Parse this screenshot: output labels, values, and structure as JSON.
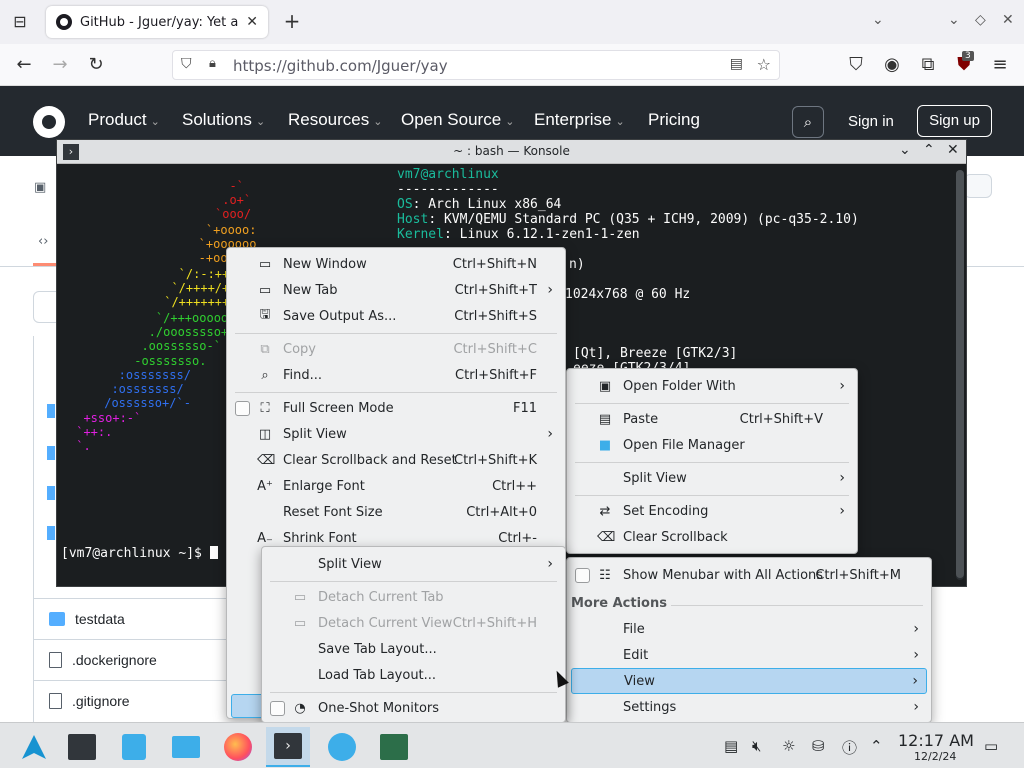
{
  "browser": {
    "tab_title": "GitHub - Jguer/yay: Yet an",
    "url": "https://github.com/Jguer/yay",
    "extension_badge": "3",
    "icons": [
      "tab-list-icon",
      "close-icon",
      "plus-icon",
      "chevron-down-icon",
      "minimize-icon",
      "restore-icon",
      "close-icon",
      "back-icon",
      "forward-icon",
      "reload-icon",
      "shield-icon",
      "lock-icon",
      "reader-icon",
      "star-icon",
      "pocket-icon",
      "account-icon",
      "extensions-icon",
      "ublock-icon",
      "hamburger-icon"
    ]
  },
  "github": {
    "nav": [
      "Product",
      "Solutions",
      "Resources",
      "Open Source",
      "Enterprise",
      "Pricing"
    ],
    "sign_in": "Sign in",
    "sign_up": "Sign up",
    "files": [
      "testdata",
      ".dockerignore",
      ".gitignore"
    ]
  },
  "konsole": {
    "title": "~ : bash — Konsole",
    "user_host": "vm7@archlinux",
    "separator": "-------------",
    "os_key": "OS",
    "os_val": ": Arch Linux x86_64",
    "host_key": "Host",
    "host_val": ": KVM/QEMU Standard PC (Q35 + ICH9, 2009) (pc-q35-2.10)",
    "kernel_key": "Kernel",
    "kernel_val": ": Linux 6.12.1-zen1-1-zen",
    "uptime_partial": "n)",
    "resolution_partial": "1024x768 @ 60 Hz",
    "theme_partial": "[Qt], Breeze [GTK2/3]",
    "icons_partial": "eeze [GTK2/3/4]",
    "prompt": "[vm7@archlinux ~]$ "
  },
  "menu_main": {
    "items": [
      {
        "label": "New Window",
        "shortcut": "Ctrl+Shift+N",
        "icon": "new-window-icon"
      },
      {
        "label": "New Tab",
        "shortcut": "Ctrl+Shift+T",
        "icon": "new-tab-icon"
      },
      {
        "label": "Save Output As...",
        "shortcut": "Ctrl+Shift+S",
        "icon": "save-icon"
      },
      {
        "label": "Copy",
        "shortcut": "Ctrl+Shift+C",
        "icon": "copy-icon"
      },
      {
        "label": "Find...",
        "shortcut": "Ctrl+Shift+F",
        "icon": "find-icon"
      },
      {
        "label": "Full Screen Mode",
        "shortcut": "F11",
        "icon": "fullscreen-icon"
      },
      {
        "label": "Split View",
        "shortcut": "",
        "icon": "split-view-icon"
      },
      {
        "label": "Clear Scrollback and Reset",
        "shortcut": "Ctrl+Shift+K",
        "icon": "clear-icon"
      },
      {
        "label": "Enlarge Font",
        "shortcut": "Ctrl++",
        "icon": "enlarge-font-icon"
      },
      {
        "label": "Reset Font Size",
        "shortcut": "Ctrl+Alt+0",
        "icon": ""
      },
      {
        "label": "Shrink Font",
        "shortcut": "Ctrl+-",
        "icon": "shrink-font-icon"
      }
    ]
  },
  "menu_split": {
    "items": [
      {
        "label": "Split View"
      },
      {
        "label": "Detach Current Tab"
      },
      {
        "label": "Detach Current View",
        "shortcut": "Ctrl+Shift+H"
      },
      {
        "label": "Save Tab Layout..."
      },
      {
        "label": "Load Tab Layout..."
      },
      {
        "label": "One-Shot Monitors"
      }
    ]
  },
  "menu_right": {
    "items": [
      {
        "label": "Open Folder With"
      },
      {
        "label": "Paste",
        "shortcut": "Ctrl+Shift+V"
      },
      {
        "label": "Open File Manager"
      },
      {
        "label": "Split View"
      },
      {
        "label": "Set Encoding"
      },
      {
        "label": "Clear Scrollback"
      }
    ]
  },
  "menu_more": {
    "show_menubar": "Show Menubar with All Actions",
    "show_menubar_shortcut": "Ctrl+Shift+M",
    "section": "More Actions",
    "items": [
      "File",
      "Edit",
      "View",
      "Settings"
    ]
  },
  "taskbar": {
    "time": "12:17 AM",
    "date": "12/2/24"
  },
  "colors": {
    "gh_header": "#24292f",
    "terminal_bg": "#1b1e20",
    "highlight": "#b6d6f1",
    "accent": "#3daee9"
  }
}
